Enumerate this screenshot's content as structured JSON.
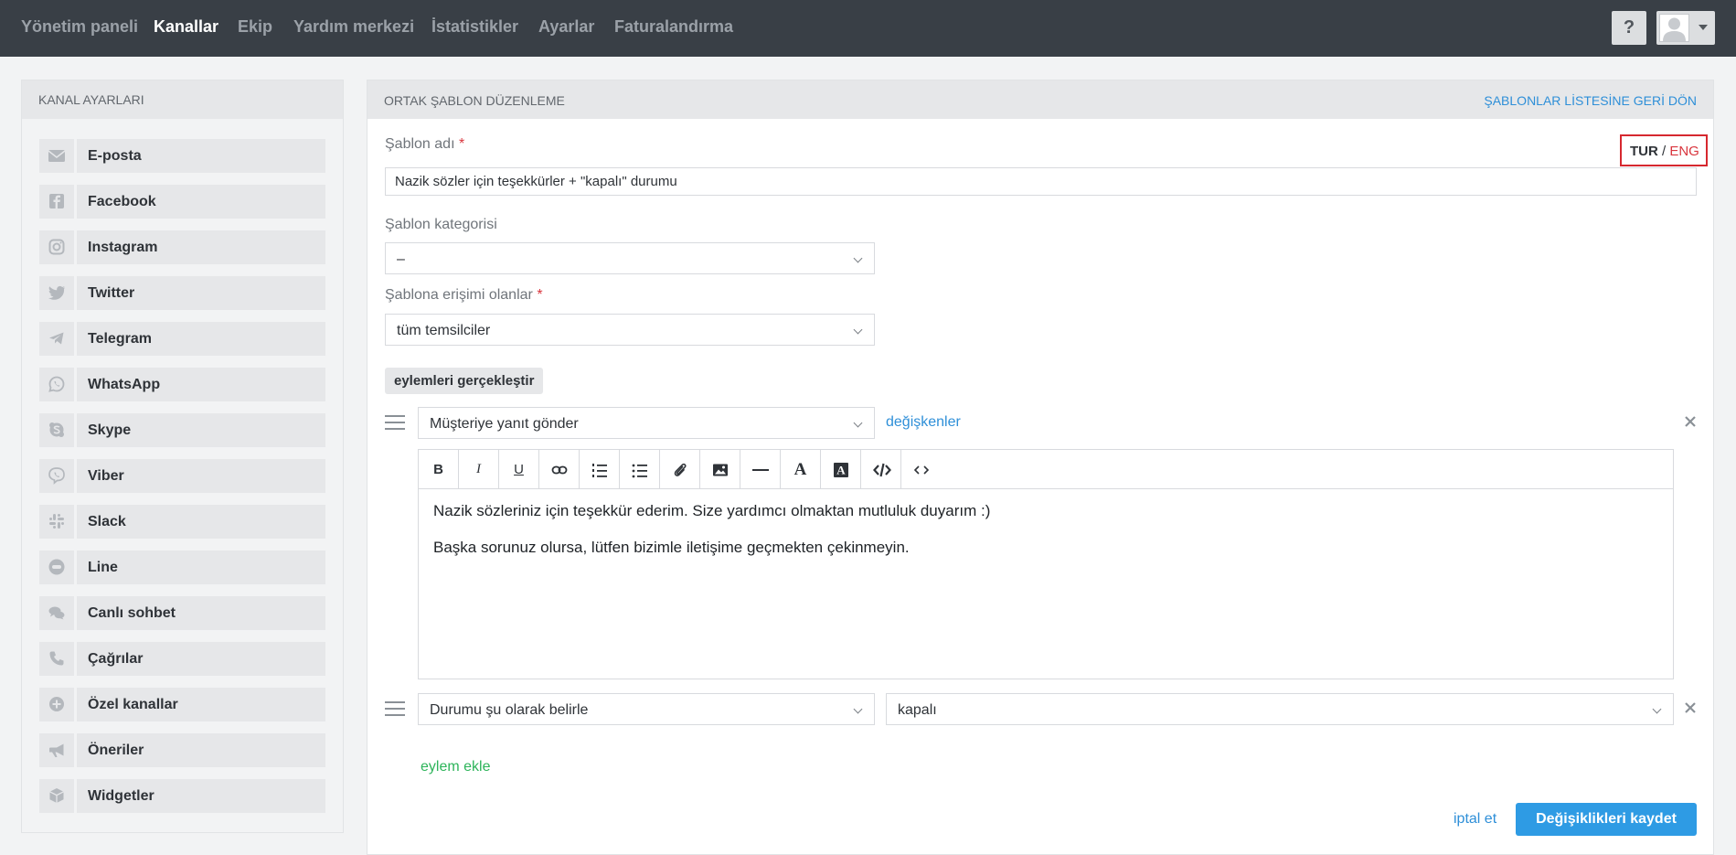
{
  "topnav": {
    "items": [
      "Yönetim paneli",
      "Kanallar",
      "Ekip",
      "Yardım merkezi",
      "İstatistikler",
      "Ayarlar",
      "Faturalandırma"
    ],
    "active": "Kanallar",
    "help_label": "?"
  },
  "sidebar": {
    "title": "KANAL AYARLARI",
    "items": [
      {
        "label": "E-posta",
        "icon": "envelope-icon"
      },
      {
        "label": "Facebook",
        "icon": "facebook-icon"
      },
      {
        "label": "Instagram",
        "icon": "instagram-icon"
      },
      {
        "label": "Twitter",
        "icon": "twitter-icon"
      },
      {
        "label": "Telegram",
        "icon": "telegram-icon"
      },
      {
        "label": "WhatsApp",
        "icon": "whatsapp-icon"
      },
      {
        "label": "Skype",
        "icon": "skype-icon"
      },
      {
        "label": "Viber",
        "icon": "viber-icon"
      },
      {
        "label": "Slack",
        "icon": "slack-icon"
      },
      {
        "label": "Line",
        "icon": "line-icon"
      },
      {
        "label": "Canlı sohbet",
        "icon": "chat-icon"
      },
      {
        "label": "Çağrılar",
        "icon": "phone-icon"
      },
      {
        "label": "Özel kanallar",
        "icon": "plus-circle-icon"
      },
      {
        "label": "Öneriler",
        "icon": "megaphone-icon"
      },
      {
        "label": "Widgetler",
        "icon": "cube-icon"
      }
    ]
  },
  "main": {
    "title": "ORTAK ŞABLON DÜZENLEME",
    "back_link": "ŞABLONLAR LİSTESİNE GERİ DÖN",
    "template_name_label": "Şablon adı",
    "required_mark": "*",
    "lang_tur": "TUR",
    "lang_sep": "/",
    "lang_eng": "ENG",
    "template_name_value": "Nazik sözler için teşekkürler + \"kapalı\" durumu",
    "category_label": "Şablon kategorisi",
    "category_value": "–",
    "access_label": "Şablona erişimi olanlar",
    "access_value": "tüm temsilciler",
    "actions_title": "eylemleri gerçekleştir",
    "action1_select": "Müşteriye yanıt gönder",
    "variables_link": "değişkenler",
    "editor_paragraphs": [
      "Nazik sözleriniz için teşekkür ederim. Size yardımcı olmaktan mutluluk duyarım :)",
      "Başka sorunuz olursa, lütfen bizimle iletişime geçmekten çekinmeyin."
    ],
    "toolbar": {
      "bold": "B",
      "italic": "I",
      "underline": "U",
      "font": "A",
      "bgcolor": "A"
    },
    "action2_select": "Durumu şu olarak belirle",
    "action2_value": "kapalı",
    "add_action": "eylem ekle",
    "cancel": "iptal et",
    "save": "Değişiklikleri kaydet"
  },
  "colors": {
    "topbar": "#393f46",
    "accent_blue": "#2e9be4",
    "link_green": "#2db45a",
    "required_red": "#d9363e"
  }
}
